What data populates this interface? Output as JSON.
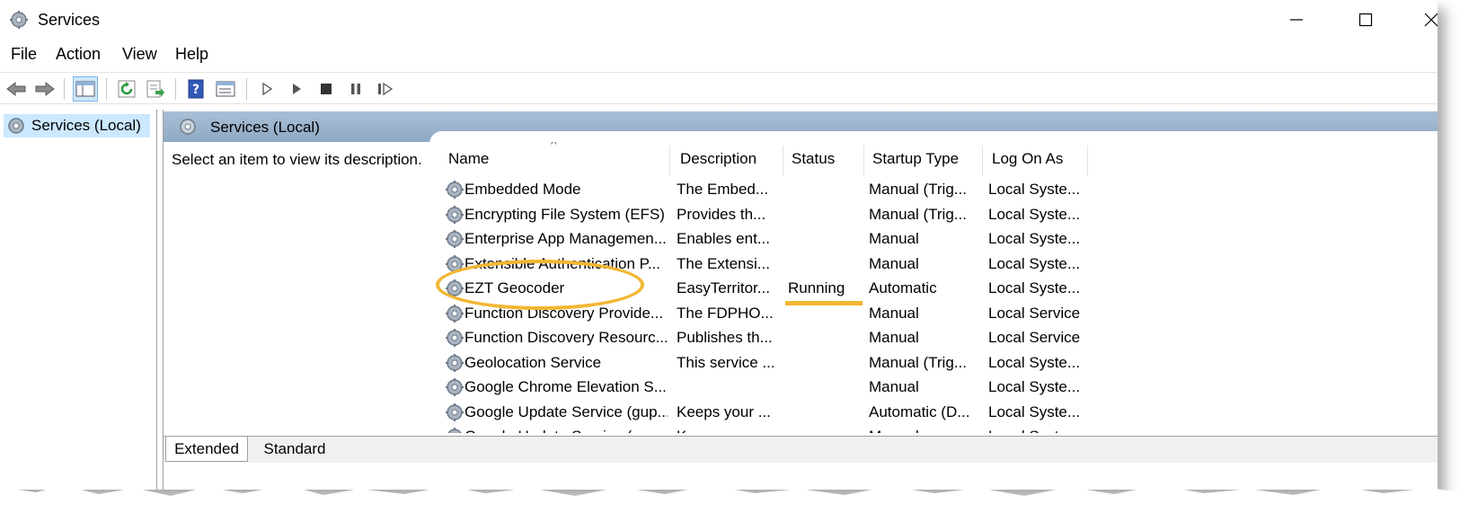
{
  "window": {
    "title": "Services"
  },
  "menu": {
    "items": [
      "File",
      "Action",
      "View",
      "Help"
    ]
  },
  "tree": {
    "selected_label": "Services (Local)"
  },
  "right_pane": {
    "header_title": "Services (Local)",
    "description_prompt": "Select an item to view its description."
  },
  "table": {
    "columns": [
      "Name",
      "Description",
      "Status",
      "Startup Type",
      "Log On As"
    ],
    "rows": [
      {
        "name": "Embedded Mode",
        "description": "The Embed...",
        "status": "",
        "startup": "Manual (Trig...",
        "logon": "Local Syste..."
      },
      {
        "name": "Encrypting File System (EFS)",
        "description": "Provides th...",
        "status": "",
        "startup": "Manual (Trig...",
        "logon": "Local Syste..."
      },
      {
        "name": "Enterprise App Managemen...",
        "description": "Enables ent...",
        "status": "",
        "startup": "Manual",
        "logon": "Local Syste..."
      },
      {
        "name": "Extensible Authentication P...",
        "description": "The Extensi...",
        "status": "",
        "startup": "Manual",
        "logon": "Local Syste..."
      },
      {
        "name": "EZT Geocoder",
        "description": "EasyTerritor...",
        "status": "Running",
        "startup": "Automatic",
        "logon": "Local Syste..."
      },
      {
        "name": "Function Discovery Provide...",
        "description": "The FDPHO...",
        "status": "",
        "startup": "Manual",
        "logon": "Local Service"
      },
      {
        "name": "Function Discovery Resourc...",
        "description": "Publishes th...",
        "status": "",
        "startup": "Manual",
        "logon": "Local Service"
      },
      {
        "name": "Geolocation Service",
        "description": "This service ...",
        "status": "",
        "startup": "Manual (Trig...",
        "logon": "Local Syste..."
      },
      {
        "name": "Google Chrome Elevation S...",
        "description": "",
        "status": "",
        "startup": "Manual",
        "logon": "Local Syste..."
      },
      {
        "name": "Google Update Service (gup...",
        "description": "Keeps your ...",
        "status": "",
        "startup": "Automatic (D...",
        "logon": "Local Syste..."
      },
      {
        "name": "Google Update Service (gup...",
        "description": "Keeps your ...",
        "status": "",
        "startup": "Manual",
        "logon": "Local Syste..."
      }
    ]
  },
  "bottom_tabs": [
    "Extended",
    "Standard"
  ],
  "colors": {
    "highlight": "#f2b632",
    "header": "#a9bfd6",
    "selection": "#cce8ff"
  }
}
